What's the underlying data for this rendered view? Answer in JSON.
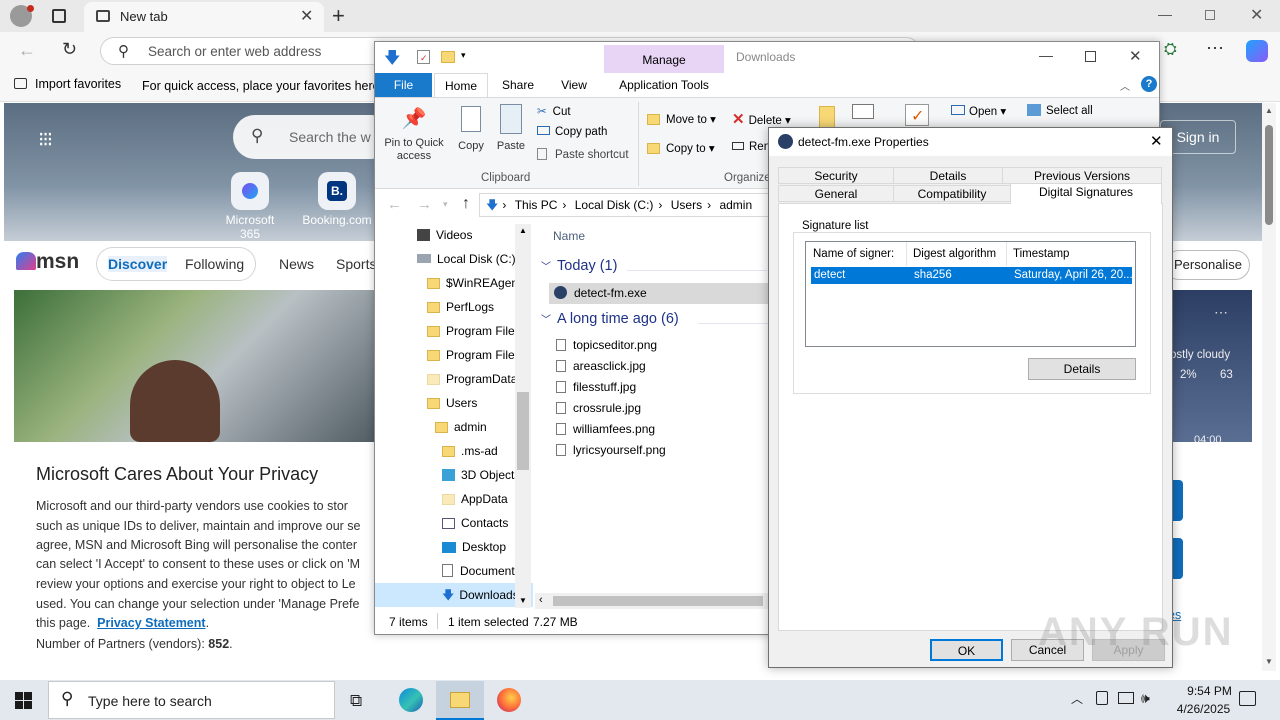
{
  "browser": {
    "tab_title": "New tab",
    "address_placeholder": "Search or enter web address",
    "favorites": {
      "import_label": "Import favorites",
      "hint": "For quick access, place your favorites here o"
    }
  },
  "msn": {
    "search_placeholder": "Search the w",
    "shortcuts": [
      {
        "label": "Microsoft 365"
      },
      {
        "label": "Booking.com"
      }
    ],
    "logo_text": "msn",
    "nav": [
      "Discover",
      "Following",
      "News",
      "Sports"
    ],
    "sign_in": "Sign in",
    "personalise": "Personalise",
    "weather": {
      "summary": "ostly cloudy",
      "precip": "2%",
      "value": "63",
      "time": "04:00"
    },
    "privacy": {
      "title": "Microsoft Cares About Your Privacy",
      "lines": [
        "Microsoft and our third-party vendors use cookies to stor",
        "such as unique IDs to deliver, maintain and improve our se",
        "agree, MSN and Microsoft Bing will personalise the conter",
        "can select 'I Accept' to consent to these uses or click on 'M",
        "review your options and exercise your right to object to Le",
        "used. You can change your selection under 'Manage Prefe"
      ],
      "line7_prefix": "this page.",
      "link": "Privacy Statement",
      "partners_label": "Number of Partners (vendors):",
      "partners_count": "852",
      "side_link": "es"
    }
  },
  "explorer": {
    "title": "Downloads",
    "manage_tab": "Manage",
    "tabs": [
      "File",
      "Home",
      "Share",
      "View",
      "Application Tools"
    ],
    "clipboard": {
      "pin": "Pin to Quick access",
      "copy": "Copy",
      "paste": "Paste",
      "cut": "Cut",
      "copy_path": "Copy path",
      "paste_shortcut": "Paste shortcut",
      "group": "Clipboard"
    },
    "organize": {
      "move_to": "Move to",
      "copy_to": "Copy to",
      "delete": "Delete",
      "rename": "Ren",
      "group": "Organize"
    },
    "open": {
      "open": "Open",
      "select_all": "Select all"
    },
    "breadcrumb": [
      "This PC",
      "Local Disk (C:)",
      "Users",
      "admin"
    ],
    "nav_tree": [
      {
        "label": "Videos"
      },
      {
        "label": "Local Disk (C:)"
      },
      {
        "label": "$WinREAgent"
      },
      {
        "label": "PerfLogs"
      },
      {
        "label": "Program Files"
      },
      {
        "label": "Program Files"
      },
      {
        "label": "ProgramData"
      },
      {
        "label": "Users"
      },
      {
        "label": "admin"
      },
      {
        "label": ".ms-ad"
      },
      {
        "label": "3D Objects"
      },
      {
        "label": "AppData"
      },
      {
        "label": "Contacts"
      },
      {
        "label": "Desktop"
      },
      {
        "label": "Documents"
      },
      {
        "label": "Downloads"
      }
    ],
    "column_name": "Name",
    "group_today": "Today (1)",
    "today_files": [
      "detect-fm.exe"
    ],
    "group_old": "A long time ago (6)",
    "old_files": [
      "topicseditor.png",
      "areasclick.jpg",
      "filesstuff.jpg",
      "crossrule.jpg",
      "williamfees.png",
      "lyricsyourself.png"
    ],
    "status": {
      "items": "7 items",
      "selected": "1 item selected",
      "size": "7.27 MB"
    }
  },
  "properties": {
    "title": "detect-fm.exe Properties",
    "tabs_row1": [
      "Security",
      "Details",
      "Previous Versions"
    ],
    "tabs_row2": [
      "General",
      "Compatibility",
      "Digital Signatures"
    ],
    "section": "Signature list",
    "columns": [
      "Name of signer:",
      "Digest algorithm",
      "Timestamp"
    ],
    "rows": [
      {
        "signer": "detect",
        "digest": "sha256",
        "timestamp": "Saturday, April 26, 20..."
      }
    ],
    "details_btn": "Details",
    "ok": "OK",
    "cancel": "Cancel",
    "apply": "Apply"
  },
  "taskbar": {
    "search_placeholder": "Type here to search",
    "time": "9:54 PM",
    "date": "4/26/2025"
  },
  "watermark": "ANY RUN",
  "colors": {
    "accent": "#0078d7",
    "selection": "#0078d7",
    "manage_tab": "#e8d5f5",
    "file_tab": "#1979ca"
  }
}
